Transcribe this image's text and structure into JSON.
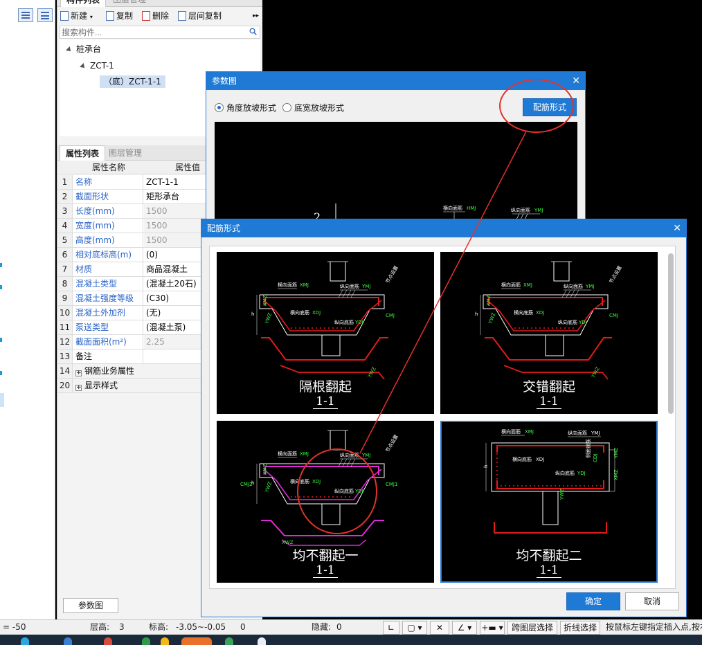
{
  "panel": {
    "top_tabs": [
      "构件列表",
      "图层管理"
    ],
    "toolbar": {
      "new": "新建",
      "copy": "复制",
      "delete": "删除",
      "floor_copy": "层间复制"
    },
    "search_placeholder": "搜索构件...",
    "tree": {
      "root": "桩承台",
      "child": "ZCT-1",
      "leaf": "（底）ZCT-1-1"
    },
    "prop_tabs": [
      "属性列表",
      "图层管理"
    ],
    "prop_headers": {
      "name": "属性名称",
      "value": "属性值"
    },
    "properties": [
      {
        "idx": "1",
        "name": "名称",
        "value": "ZCT-1-1"
      },
      {
        "idx": "2",
        "name": "截面形状",
        "value": "矩形承台"
      },
      {
        "idx": "3",
        "name": "长度(mm)",
        "value": "1500"
      },
      {
        "idx": "4",
        "name": "宽度(mm)",
        "value": "1500"
      },
      {
        "idx": "5",
        "name": "高度(mm)",
        "value": "1500"
      },
      {
        "idx": "6",
        "name": "相对底标高(m)",
        "value": "(0)"
      },
      {
        "idx": "7",
        "name": "材质",
        "value": "商品混凝土"
      },
      {
        "idx": "8",
        "name": "混凝土类型",
        "value": "(混凝土20石)"
      },
      {
        "idx": "9",
        "name": "混凝土强度等级",
        "value": "(C30)"
      },
      {
        "idx": "10",
        "name": "混凝土外加剂",
        "value": "(无)"
      },
      {
        "idx": "11",
        "name": "泵送类型",
        "value": "(混凝土泵)"
      },
      {
        "idx": "12",
        "name": "截面面积(m²)",
        "value": "2.25"
      },
      {
        "idx": "13",
        "name": "备注",
        "value": ""
      },
      {
        "idx": "14",
        "name": "钢筋业务属性",
        "value": ""
      },
      {
        "idx": "20",
        "name": "显示样式",
        "value": ""
      }
    ],
    "param_button": "参数图"
  },
  "param_dialog": {
    "title": "参数图",
    "radio_angle": "角度放坡形式",
    "radio_width": "底宽放坡形式",
    "rebar_button": "配筋形式",
    "canvas_labels": {
      "num": "2",
      "horiz": "横向面筋",
      "vert": "纵向面筋",
      "hcode": "HMJ",
      "vcode": "YMJ"
    }
  },
  "rebar_dialog": {
    "title": "配筋形式",
    "options": [
      {
        "title": "隔根翻起",
        "section": "1-1"
      },
      {
        "title": "交错翻起",
        "section": "1-1"
      },
      {
        "title": "均不翻起一",
        "section": "1-1"
      },
      {
        "title": "均不翻起二",
        "section": "1-1"
      }
    ],
    "drawing_labels": {
      "top_x": "横向面筋",
      "top_x_code": "XMJ",
      "top_y": "纵向面筋",
      "top_y_code": "YMJ",
      "bot_x": "横向底筋",
      "bot_x_code": "XDJ",
      "bot_y": "纵向底筋",
      "bot_y_code": "YDJ",
      "node": "节点设置",
      "cmj": "CMJ",
      "cmj1": "CMJ1",
      "cmj2": "CMJ2",
      "xmz": "XMZ",
      "ymz": "YMZ",
      "xwz": "XWZ",
      "ywz": "YWZ",
      "h": "h",
      "cdj": "CDJ",
      "side": "侧面钢筋",
      "xmj_label": "XMJ",
      "ymj_label": "YMJ"
    },
    "ok": "确定",
    "cancel": "取消"
  },
  "status": {
    "coord": "= -50",
    "floor_height_label": "层高:",
    "floor_height": "3",
    "elev_label": "标高:",
    "elev": "-3.05~-0.05",
    "zero": "0",
    "hidden_label": "隐藏:",
    "hidden": "0",
    "cross_layer": "跨图层选择",
    "polyline": "折线选择",
    "hint": "按鼠标左键指定插入点,按右"
  },
  "colors": {
    "accent": "#1f7ad6",
    "red": "#e41b1b",
    "green": "#3dff3d",
    "magenta": "#e02ad8",
    "annotation": "#e4322b"
  }
}
